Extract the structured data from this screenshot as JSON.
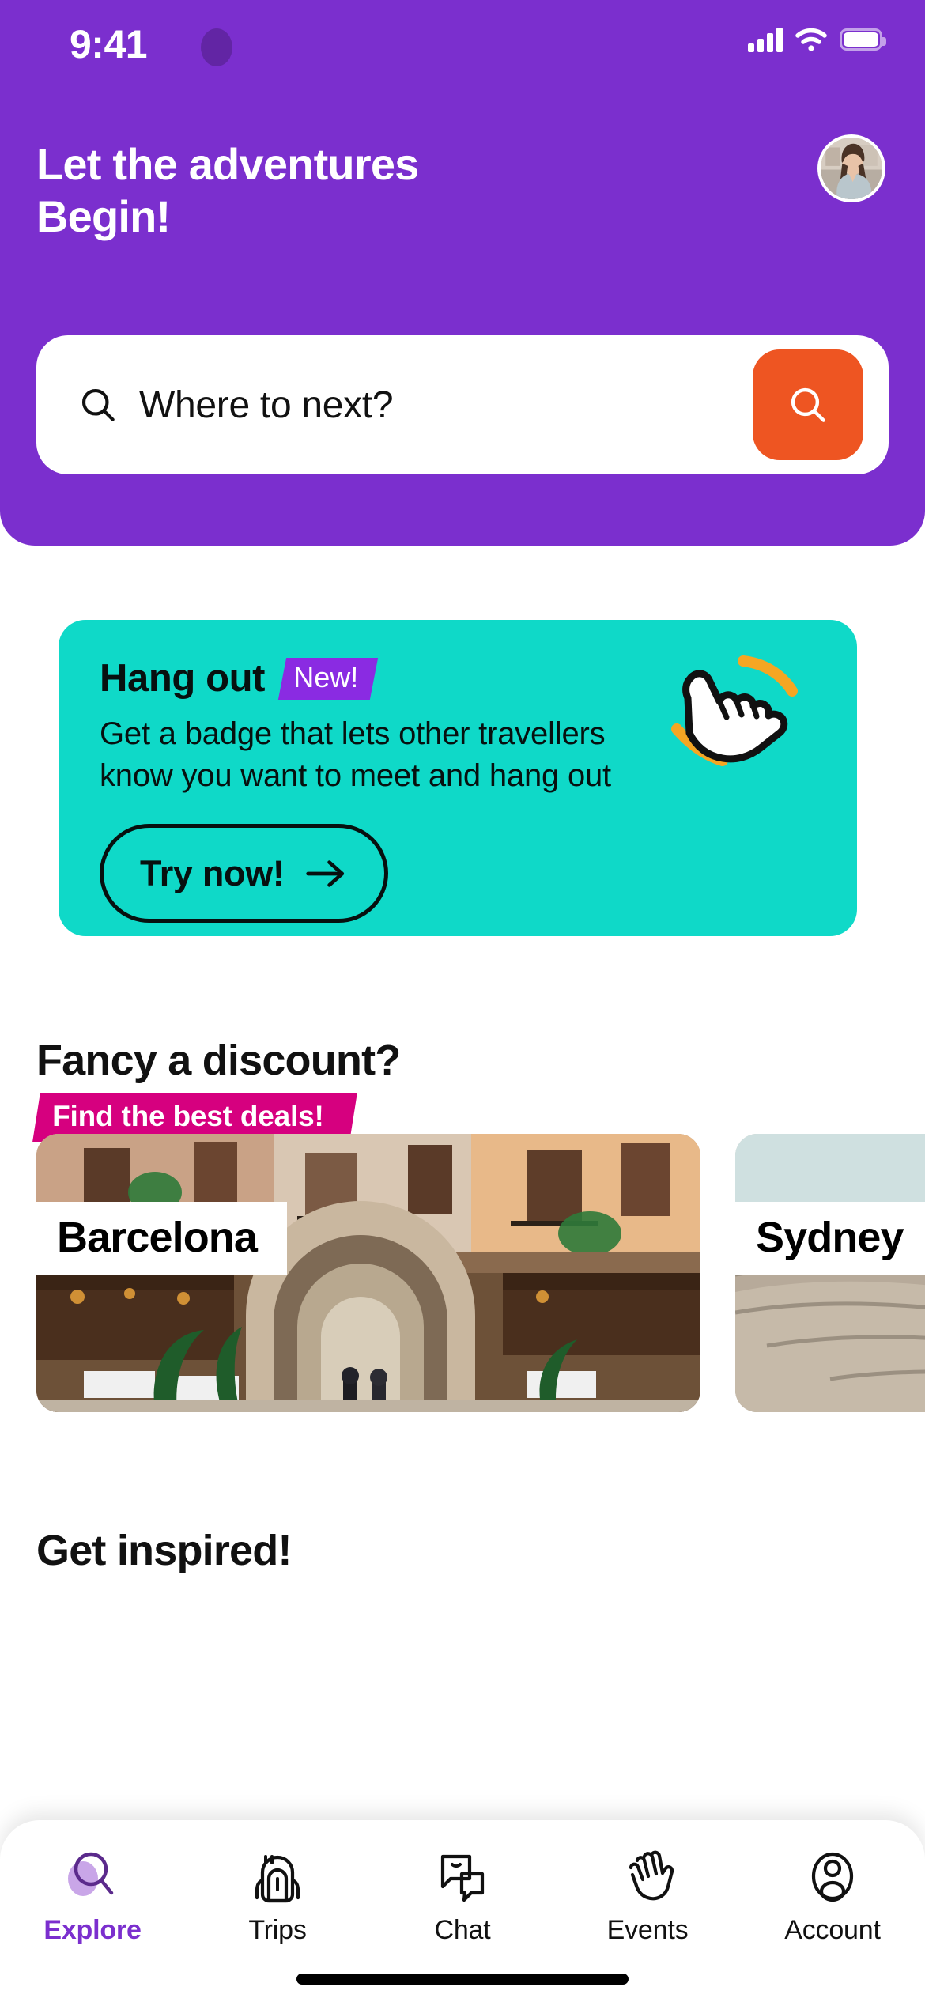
{
  "status_bar": {
    "time": "9:41",
    "cellular_icon": "signal-bars-icon",
    "wifi_icon": "wifi-icon",
    "battery_icon": "battery-icon"
  },
  "header": {
    "greeting": "Let the adventures Begin!",
    "avatar_name": "user-avatar",
    "background_color": "#7B2FCE"
  },
  "search": {
    "placeholder": "Where to next?",
    "value": "",
    "leading_icon": "search-icon",
    "button_icon": "search-icon",
    "button_color": "#EE5522"
  },
  "hangout_card": {
    "title": "Hang out",
    "badge": "New!",
    "badge_color": "#8A2BE2",
    "description": "Get a badge that lets other travellers know you want to meet and hang out",
    "cta_label": "Try now!",
    "cta_icon": "arrow-right-icon",
    "illustration": "shaka-hand-icon",
    "background_color": "#0FD9C8"
  },
  "discount_section": {
    "title": "Fancy a discount?",
    "badge": "Find the best deals!",
    "badge_color": "#D6007F",
    "cities": [
      {
        "name": "Barcelona",
        "photo": "barcelona-gothic-quarter-photo"
      },
      {
        "name": "Sydney",
        "photo": "sydney-coastal-rocks-photo"
      }
    ]
  },
  "inspired_section": {
    "title": "Get inspired!"
  },
  "tab_bar": {
    "active": "Explore",
    "active_color": "#7B2FCE",
    "items": [
      {
        "label": "Explore",
        "icon": "magnifier-icon"
      },
      {
        "label": "Trips",
        "icon": "backpack-icon"
      },
      {
        "label": "Chat",
        "icon": "chat-bubbles-icon"
      },
      {
        "label": "Events",
        "icon": "waving-hands-icon"
      },
      {
        "label": "Account",
        "icon": "person-circle-icon"
      }
    ]
  }
}
